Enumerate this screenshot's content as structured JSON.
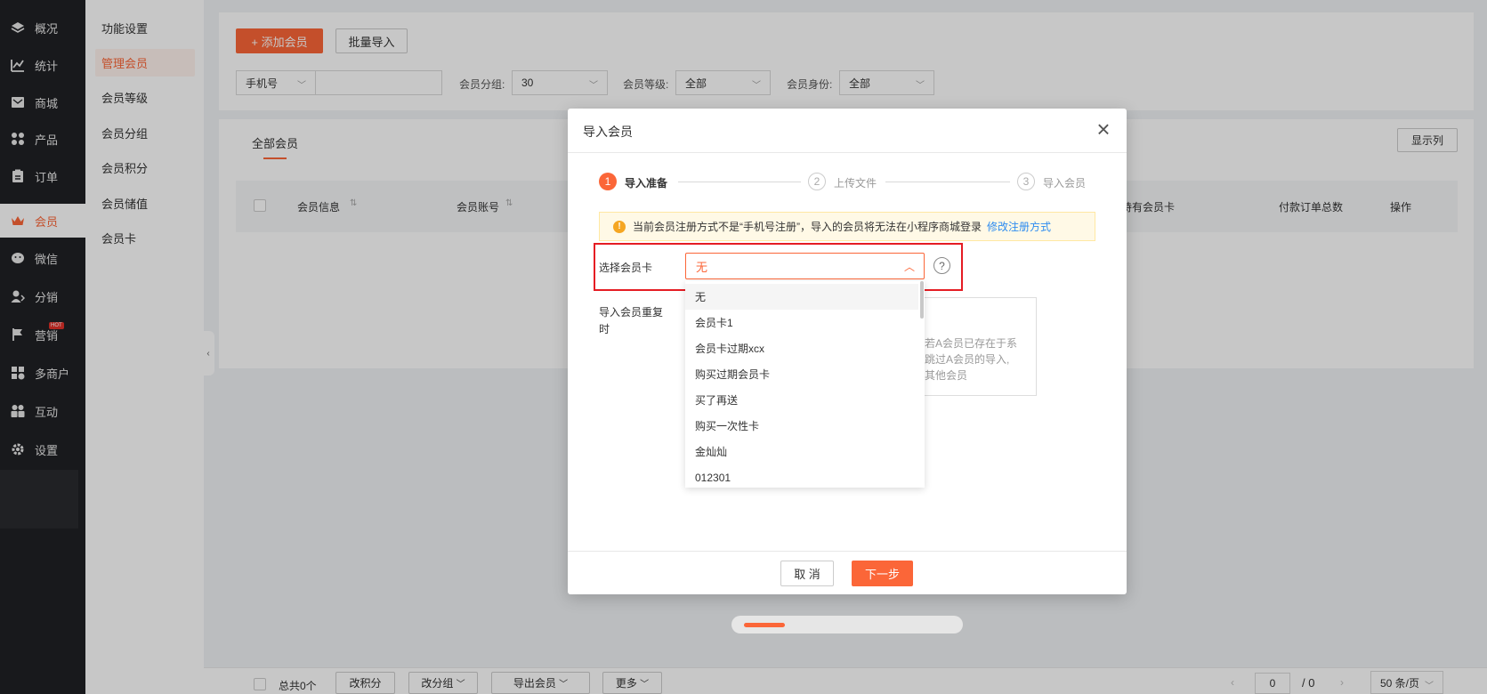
{
  "sidebar": {
    "items": [
      {
        "label": "概况",
        "icon": "layers-icon"
      },
      {
        "label": "统计",
        "icon": "stats-icon"
      },
      {
        "label": "商城",
        "icon": "mail-icon"
      },
      {
        "label": "产品",
        "icon": "grid-icon"
      },
      {
        "label": "订单",
        "icon": "order-icon"
      },
      {
        "label": "会员",
        "icon": "crown-icon"
      },
      {
        "label": "微信",
        "icon": "wechat-icon"
      },
      {
        "label": "分销",
        "icon": "distribution-icon"
      },
      {
        "label": "营销",
        "icon": "flag-icon"
      },
      {
        "label": "多商户",
        "icon": "merchant-icon"
      },
      {
        "label": "互动",
        "icon": "interaction-icon"
      },
      {
        "label": "设置",
        "icon": "gear-icon"
      }
    ],
    "hot_badge": "HOT"
  },
  "submenu": {
    "items": [
      "功能设置",
      "管理会员",
      "会员等级",
      "会员分组",
      "会员积分",
      "会员储值",
      "会员卡"
    ]
  },
  "toolbar": {
    "add_member": "+ 添加会员",
    "batch_import": "批量导入"
  },
  "filters": {
    "search_type": "手机号",
    "group_label": "会员分组:",
    "group_value": "30",
    "level_label": "会员等级:",
    "level_value": "全部",
    "identity_label": "会员身份:",
    "identity_value": "全部"
  },
  "list": {
    "tab": "全部会员",
    "display_columns": "显示列",
    "headers": [
      "会员信息",
      "会员账号",
      "持有会员卡",
      "付款订单总数",
      "操作"
    ]
  },
  "footer": {
    "total": "总共0个",
    "change_points": "改积分",
    "change_group": "改分组",
    "export": "导出会员",
    "more": "更多",
    "page_current": "0",
    "page_total": "/ 0",
    "page_size": "50 条/页"
  },
  "modal": {
    "title": "导入会员",
    "steps": [
      {
        "num": "1",
        "label": "导入准备"
      },
      {
        "num": "2",
        "label": "上传文件"
      },
      {
        "num": "3",
        "label": "导入会员"
      }
    ],
    "notice_text": "当前会员注册方式不是“手机号注册”，导入的会员将无法在小程序商城登录",
    "notice_link": "修改注册方式",
    "card_label": "选择会员卡",
    "card_value": "无",
    "duplicate_label_1": "导入会员重复",
    "duplicate_label_2": "时",
    "option_text_lines": [
      "若A会员已存在于系",
      "跳过A会员的导入,",
      "其他会员"
    ],
    "dropdown_options": [
      "无",
      "会员卡1",
      "会员卡过期xcx",
      "购买过期会员卡",
      "买了再送",
      "购买一次性卡",
      "金灿灿",
      "012301"
    ],
    "cancel": "取 消",
    "next": "下一步"
  },
  "colors": {
    "accent": "#fb6638",
    "sidebar_bg": "#1f2024",
    "highlight_border": "#e51c23",
    "link": "#2d8cf0"
  }
}
